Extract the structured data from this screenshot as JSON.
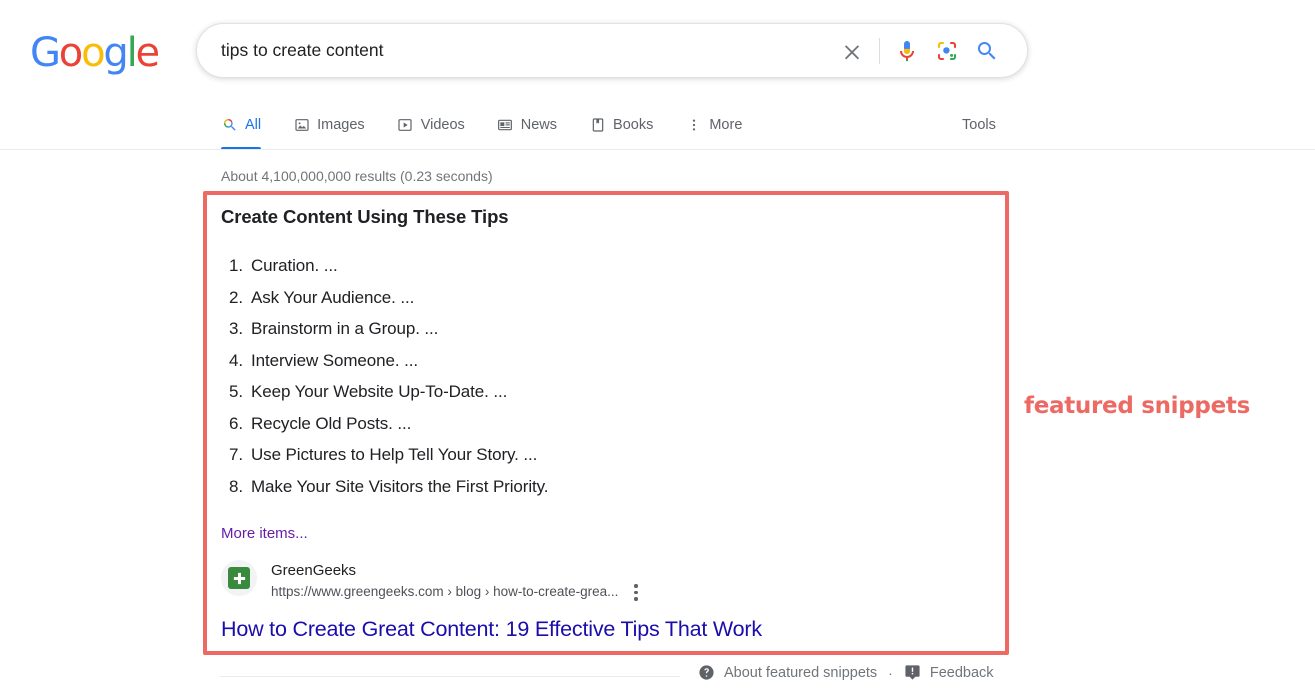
{
  "header": {
    "logo": {
      "alt": "Google",
      "letters": [
        {
          "char": "G",
          "color": "#4285f4"
        },
        {
          "char": "o",
          "color": "#ea4335"
        },
        {
          "char": "o",
          "color": "#fbbc05"
        },
        {
          "char": "g",
          "color": "#4285f4"
        },
        {
          "char": "l",
          "color": "#34a853"
        },
        {
          "char": "e",
          "color": "#ea4335"
        }
      ]
    },
    "search": {
      "value": "tips to create content",
      "placeholder": "Search Google or type a URL",
      "clear_icon": "close-icon",
      "voice_icon": "microphone-icon",
      "lens_icon": "google-lens-icon",
      "submit_icon": "search-icon"
    }
  },
  "nav": {
    "tabs": [
      {
        "label": "All",
        "icon": "search-icon",
        "active": true
      },
      {
        "label": "Images",
        "icon": "image-icon",
        "active": false
      },
      {
        "label": "Videos",
        "icon": "video-icon",
        "active": false
      },
      {
        "label": "News",
        "icon": "news-icon",
        "active": false
      },
      {
        "label": "Books",
        "icon": "book-icon",
        "active": false
      },
      {
        "label": "More",
        "icon": "more-vertical-icon",
        "active": false
      }
    ],
    "tools_label": "Tools"
  },
  "results": {
    "stats": "About 4,100,000,000 results (0.23 seconds)",
    "featured_snippet": {
      "title": "Create Content Using These Tips",
      "items": [
        {
          "num": "1.",
          "text": "Curation. ..."
        },
        {
          "num": "2.",
          "text": "Ask Your Audience. ..."
        },
        {
          "num": "3.",
          "text": "Brainstorm in a Group. ..."
        },
        {
          "num": "4.",
          "text": "Interview Someone. ..."
        },
        {
          "num": "5.",
          "text": "Keep Your Website Up-To-Date. ..."
        },
        {
          "num": "6.",
          "text": "Recycle Old Posts. ..."
        },
        {
          "num": "7.",
          "text": "Use Pictures to Help Tell Your Story. ..."
        },
        {
          "num": "8.",
          "text": "Make Your Site Visitors the First Priority."
        }
      ],
      "more_items_label": "More items...",
      "source": {
        "name": "GreenGeeks",
        "url": "https://www.greengeeks.com › blog › how-to-create-grea...",
        "favicon": "greengeeks-favicon",
        "menu_icon": "kebab-menu-icon"
      },
      "result_title": "How to Create Great Content: 19 Effective Tips That Work"
    }
  },
  "footer": {
    "about_icon": "help-circle-icon",
    "about_label": "About featured snippets",
    "separator": "·",
    "feedback_icon": "feedback-flag-icon",
    "feedback_label": "Feedback"
  },
  "annotation": {
    "label": "featured snippets",
    "color": "#ec6a63"
  }
}
